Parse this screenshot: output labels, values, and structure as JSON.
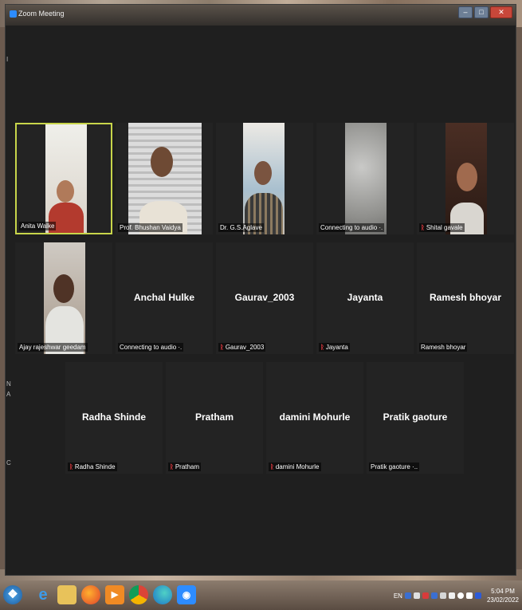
{
  "window": {
    "title": "Zoom Meeting",
    "minimize": "–",
    "maximize": "□",
    "close": "✕"
  },
  "side_letters": {
    "n": "N",
    "a": "A",
    "c": "C",
    "top": "I"
  },
  "tiles_row1": [
    {
      "name": "Anita Walke",
      "label": "Anita Walke",
      "muted": false,
      "active": true
    },
    {
      "name": "Prof. Bhushan Vaidya",
      "label": "Prof. Bhushan Vaidya",
      "muted": false
    },
    {
      "name": "Dr. G.S.Aglave",
      "label": "Dr. G.S.Aglave",
      "muted": false
    },
    {
      "name": "Connecting to audio",
      "label": "Connecting to audio ·.",
      "muted": false
    },
    {
      "name": "Shital gavale",
      "label": "Shital gavale",
      "muted": true
    }
  ],
  "tiles_row2": [
    {
      "name": "Ajay rajeshwar geedam",
      "label": "Ajay rajeshwar geedam",
      "muted": false
    },
    {
      "name": "Anchal Hulke",
      "label": "Connecting to audio ·.",
      "muted": false
    },
    {
      "name": "Gaurav_2003",
      "label": "Gaurav_2003",
      "muted": true
    },
    {
      "name": "Jayanta",
      "label": "Jayanta",
      "muted": true
    },
    {
      "name": "Ramesh bhoyar",
      "label": "Ramesh bhoyar",
      "muted": false
    }
  ],
  "tiles_row3": [
    {
      "name": "Radha Shinde",
      "label": "Radha Shinde",
      "muted": true
    },
    {
      "name": "Pratham",
      "label": "Pratham",
      "muted": true
    },
    {
      "name": "damini Mohurle",
      "label": "damini Mohurle",
      "muted": true
    },
    {
      "name": "Pratik gaoture",
      "label": "Pratik gaoture ·..",
      "muted": false
    }
  ],
  "mic_off_icon": "ᚱ",
  "taskbar": {
    "apps": [
      "start-orb-icon",
      "ie-icon",
      "file-explorer-icon",
      "firefox-icon",
      "media-icon",
      "chrome-icon",
      "edge-icon",
      "zoom-icon"
    ],
    "language": "EN",
    "time": "5:04 PM",
    "date": "23/02/2022"
  },
  "colors": {
    "active_border": "#c8d54a",
    "mic_off": "#e0393e",
    "tile_bg": "#232323",
    "window_bg": "#1f1f1f"
  }
}
